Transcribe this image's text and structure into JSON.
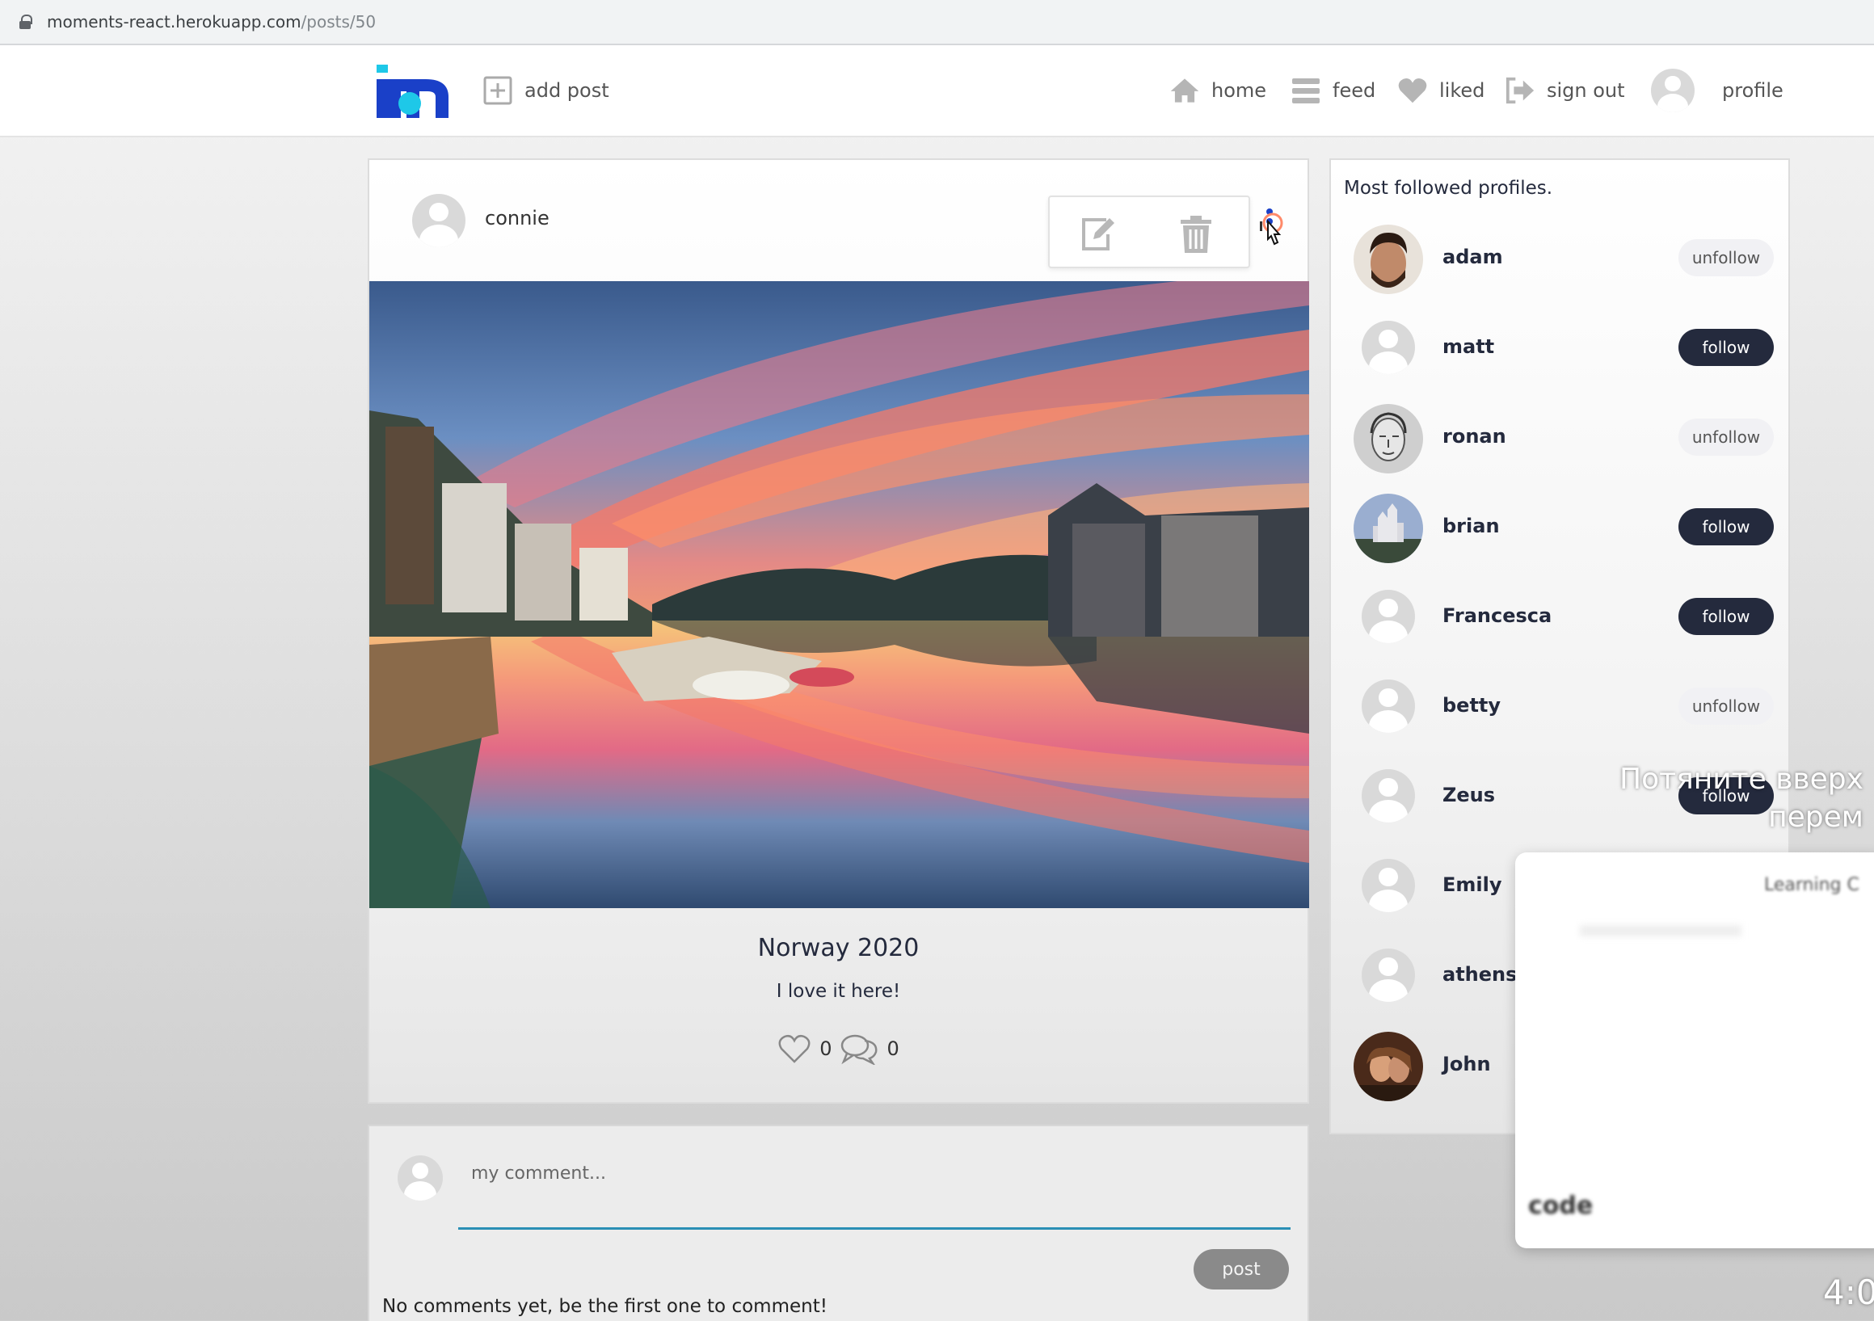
{
  "browser": {
    "url_host": "moments-react.herokuapp.com",
    "url_path": "/posts/50"
  },
  "nav": {
    "logo_alt": "moments logo",
    "add_post": "add post",
    "home": "home",
    "feed": "feed",
    "liked": "liked",
    "sign_out": "sign out",
    "profile": "profile"
  },
  "post": {
    "author": "connie",
    "title": "Norway 2020",
    "content": "I love it here!",
    "likes_count": "0",
    "comments_count": "0"
  },
  "comments": {
    "placeholder": "my comment...",
    "post_button": "post",
    "empty_message": "No comments yet, be the first one to comment!"
  },
  "sidebar": {
    "title": "Most followed profiles.",
    "profiles": [
      {
        "name": "adam",
        "button": "unfollow"
      },
      {
        "name": "matt",
        "button": "follow"
      },
      {
        "name": "ronan",
        "button": "unfollow"
      },
      {
        "name": "brian",
        "button": "follow"
      },
      {
        "name": "Francesca",
        "button": "follow"
      },
      {
        "name": "betty",
        "button": "unfollow"
      },
      {
        "name": "Zeus",
        "button": "follow"
      },
      {
        "name": "Emily",
        "button": ""
      },
      {
        "name": "athens",
        "button": ""
      },
      {
        "name": "John",
        "button": ""
      }
    ]
  },
  "overlay": {
    "caption_line1": "Потяните вверх",
    "caption_line2": "перем",
    "panel_label": "Learning C",
    "panel_logo": "code",
    "timestamp": "4:0"
  },
  "colors": {
    "brand_navy": "#242a3d",
    "logo_blue": "#1a40c8",
    "logo_cyan": "#1ec8e8",
    "input_underline": "#2a8fb5"
  }
}
